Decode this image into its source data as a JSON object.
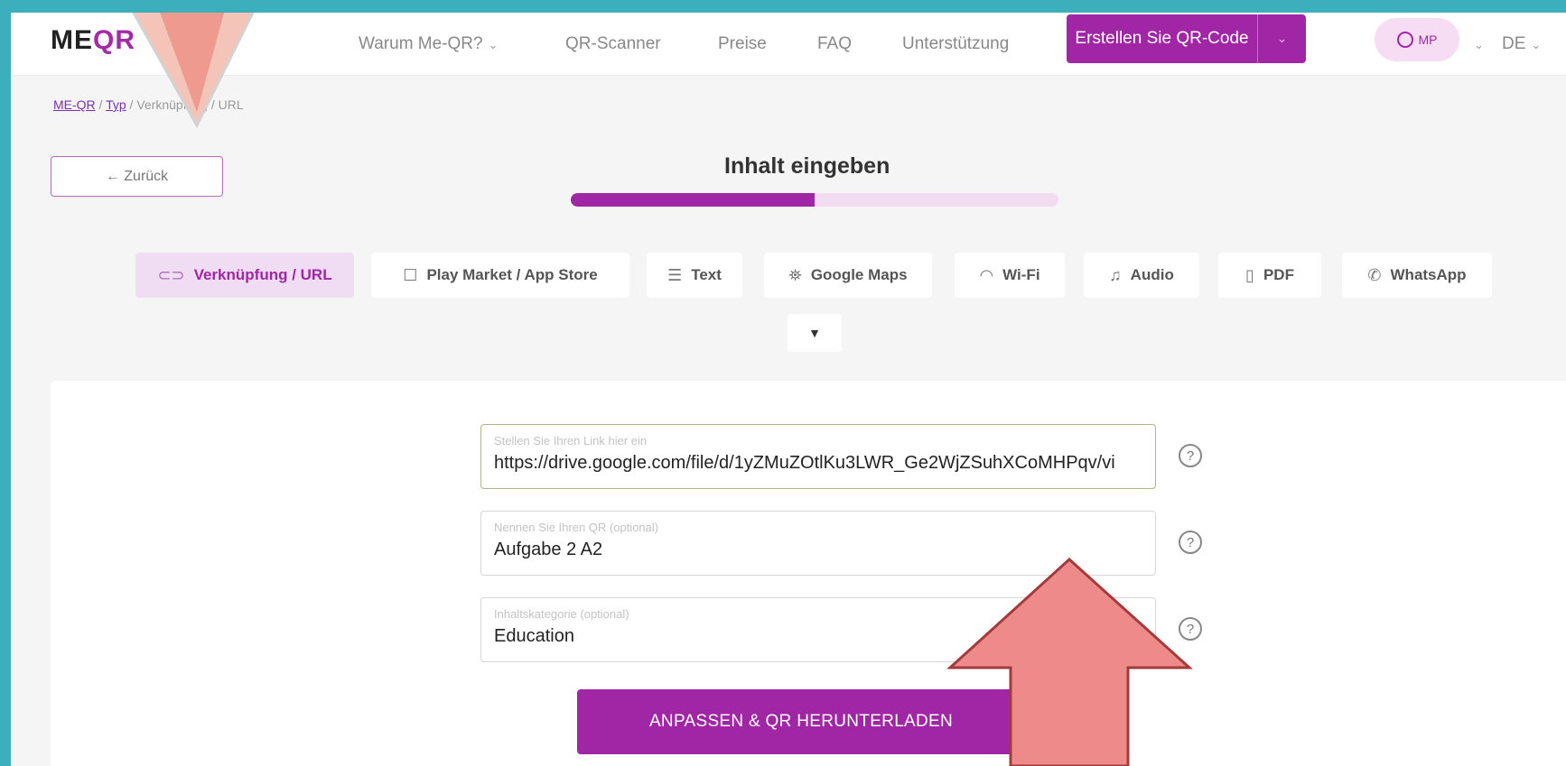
{
  "header": {
    "logo_prefix": "ME",
    "logo_suffix": "QR",
    "nav": [
      {
        "label": "Warum Me-QR?",
        "chevron": "⌄"
      },
      {
        "label": "QR-Scanner"
      },
      {
        "label": "Preise"
      },
      {
        "label": "FAQ"
      },
      {
        "label": "Unterstützung"
      }
    ],
    "create_button": "Erstellen Sie QR-Code",
    "user_initials": "MP",
    "language": "DE"
  },
  "breadcrumb": {
    "items": [
      "ME-QR",
      "Typ",
      "Verknüpfung",
      "URL"
    ],
    "separator": " / "
  },
  "back_button": "← Zurück",
  "step": {
    "title": "Inhalt eingeben",
    "progress_percent": 50
  },
  "tabs": [
    {
      "label": "Verknüpfung / URL",
      "icon": "link-icon",
      "glyph": "⊂⊃",
      "active": true
    },
    {
      "label": "Play Market / App Store",
      "icon": "app-store-icon",
      "glyph": "☐"
    },
    {
      "label": "Text",
      "icon": "text-icon",
      "glyph": "☰"
    },
    {
      "label": "Google Maps",
      "icon": "map-pin-icon",
      "glyph": "⛯"
    },
    {
      "label": "Wi-Fi",
      "icon": "wifi-icon",
      "glyph": "◠"
    },
    {
      "label": "Audio",
      "icon": "music-icon",
      "glyph": "♫"
    },
    {
      "label": "PDF",
      "icon": "pdf-icon",
      "glyph": "▯"
    },
    {
      "label": "WhatsApp",
      "icon": "whatsapp-icon",
      "glyph": "✆"
    }
  ],
  "more_tabs_glyph": "▼",
  "form": {
    "fields": [
      {
        "label": "Stellen Sie Ihren Link hier ein",
        "value": "https://drive.google.com/file/d/1yZMuZOtlKu3LWR_Ge2WjZSuhXCoMHPqv/vi"
      },
      {
        "label": "Nennen Sie Ihren QR (optional)",
        "value": "Aufgabe 2 A2"
      },
      {
        "label": "Inhaltskategorie (optional)",
        "value": "Education"
      }
    ],
    "help_glyph": "?",
    "submit_label": "ANPASSEN & QR HERUNTERLADEN"
  },
  "colors": {
    "brand": "#a026a6",
    "brand_light": "#f0dcf3",
    "frame_bg": "#3bb0bc",
    "annotation_arrow": "#ee8a8a"
  }
}
